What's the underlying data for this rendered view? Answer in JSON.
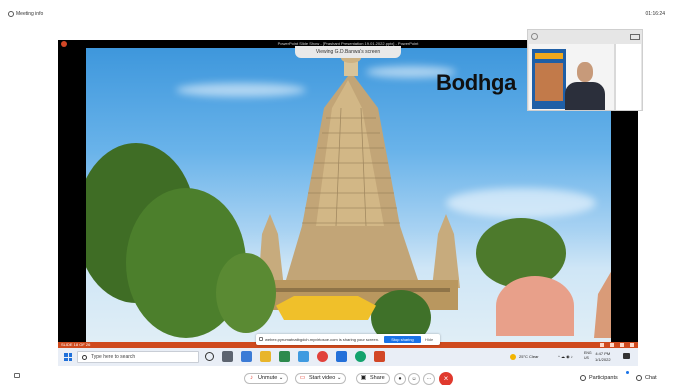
{
  "topbar": {
    "meeting_info": "Meeting info",
    "clock": "01:16:24"
  },
  "share": {
    "ppt_title": "PowerPoint Slide Show - [Prashant Presentation 19.01.2022.pptx] - PowerPoint",
    "viewing_label": "Viewing G.D.Banwa's screen",
    "slide_title": "Bodhga",
    "status_left": "SLIDE 18 OF 26",
    "notice": {
      "text": "webex.pyrumatnatbgdch.myvirtosoe.com is sharing your screen.",
      "stop_label": "Stop sharing",
      "hide_label": "Hide"
    }
  },
  "taskbar": {
    "search_placeholder": "Type here to search",
    "weather": "25°C  Clear",
    "lang": "ENG\nUS",
    "time": "4:47 PM",
    "date": "1/1/2022"
  },
  "toolbar": {
    "unmute": "Unmute",
    "start_video": "Start video",
    "share": "Share",
    "participants": "Participants",
    "chat": "Chat"
  },
  "colors": {
    "accent": "#1a73e8",
    "leave": "#e0392d",
    "ppt": "#cf4a1e"
  }
}
